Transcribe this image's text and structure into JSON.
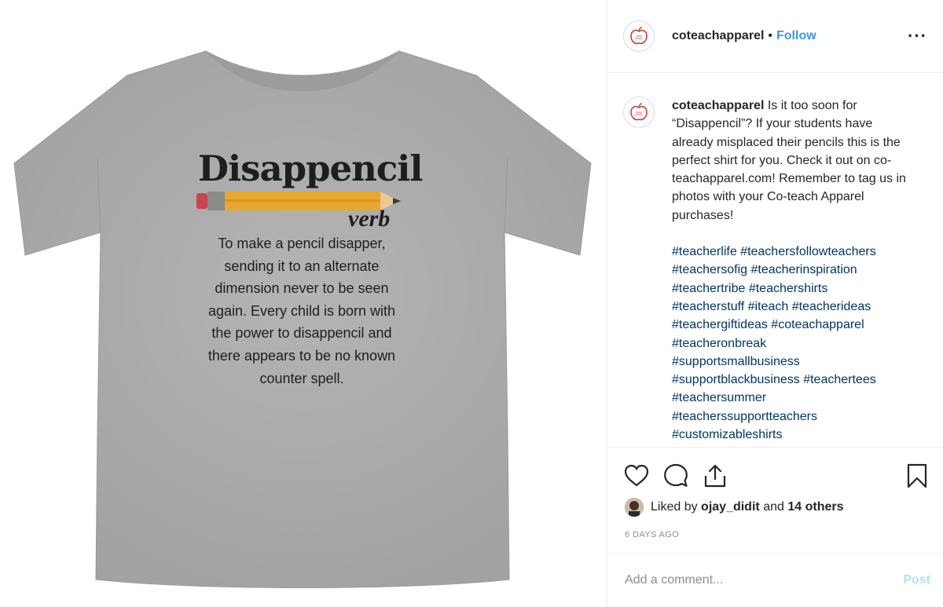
{
  "post": {
    "username": "coteachapparel",
    "separator": "•",
    "follow_label": "Follow",
    "more_label": "···"
  },
  "shirt": {
    "word": "Disappencil",
    "part_of_speech": "verb",
    "definition": "To make a pencil disapper, sending it to an alternate dimension never to be seen again. Every child is born with the power to disappencil and there appears to be no known counter spell."
  },
  "caption": {
    "username": "coteachapparel",
    "text": "Is it too soon for “Disappencil”? If your students have already misplaced their pencils this is the perfect shirt for you. Check it out on co-teachapparel.com! Remember to tag us in photos with your Co-teach Apparel purchases!",
    "hashtag_lines": [
      "#teacherlife #teachersfollowteachers",
      "#teachersofig #teacherinspiration",
      "#teachertribe #teachershirts",
      "#teacherstuff #iteach #teacherideas",
      "#teachergiftideas #coteachapparel",
      "#teacheronbreak",
      "#supportsmallbusiness",
      "#supportblackbusiness #teachertees",
      "#teachersummer",
      "#teacherssupportteachers",
      "#customizableshirts"
    ]
  },
  "likes": {
    "prefix": "Liked by",
    "user": "ojay_didit",
    "and": "and",
    "others": "14 others"
  },
  "timestamp": "6 DAYS AGO",
  "comment": {
    "placeholder": "Add a comment...",
    "post_label": "Post"
  },
  "icons": [
    "heart-icon",
    "comment-icon",
    "share-icon",
    "bookmark-icon",
    "more-icon"
  ],
  "colors": {
    "follow": "#3897f0",
    "hashtag": "#003569",
    "post_disabled": "#b2dffc",
    "shirt": "#a9a9a9",
    "pencil": "#e8a82e"
  }
}
